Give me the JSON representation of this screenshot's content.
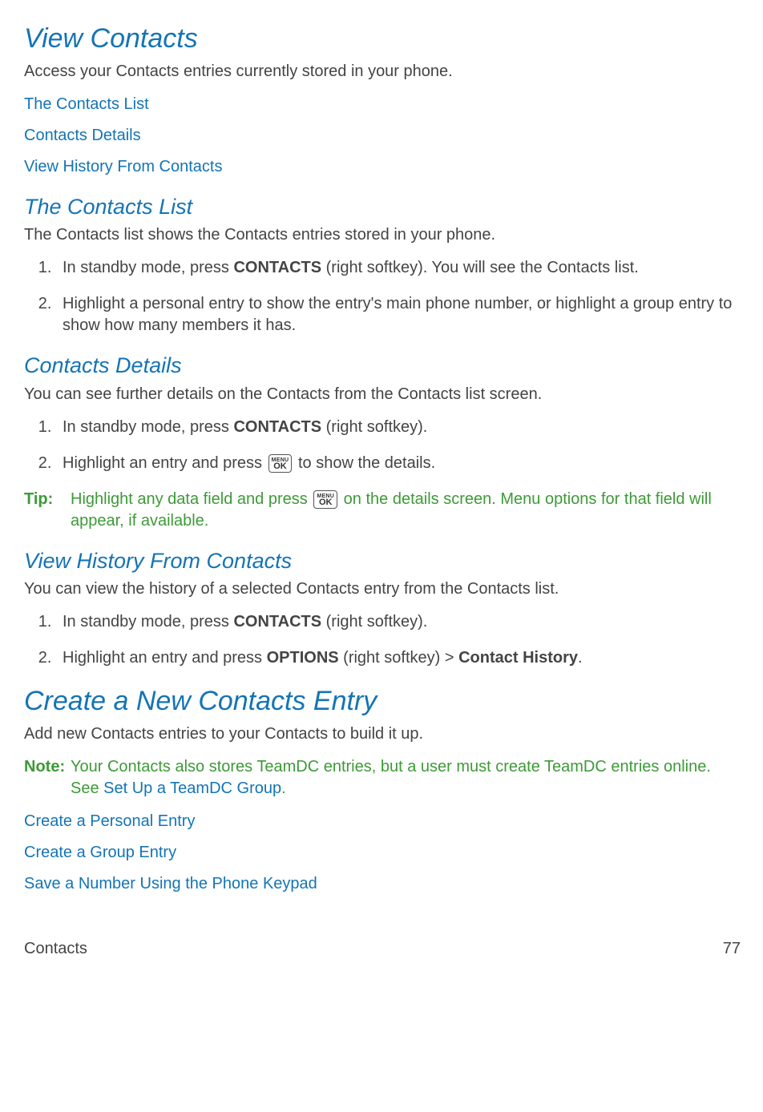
{
  "section1": {
    "title": "View Contacts",
    "desc": "Access your Contacts entries currently stored in your phone.",
    "links": [
      "The Contacts List",
      "Contacts Details",
      "View History From Contacts"
    ]
  },
  "section2": {
    "title": "The Contacts List",
    "desc": "The Contacts list shows the Contacts entries stored in your phone.",
    "step1_a": "In standby mode, press ",
    "step1_b": "CONTACTS",
    "step1_c": " (right softkey). You will see the Contacts list.",
    "step2": "Highlight a personal entry to show the entry's main phone number, or highlight a group entry to show how many members it has."
  },
  "section3": {
    "title": "Contacts Details",
    "desc": "You can see further details on the Contacts from the Contacts list screen.",
    "step1_a": "In standby mode, press ",
    "step1_b": "CONTACTS",
    "step1_c": " (right softkey).",
    "step2_a": "Highlight an entry and press ",
    "step2_b": " to show the details.",
    "tip_label": "Tip:",
    "tip_a": "Highlight any data field and press ",
    "tip_b": " on the details screen. Menu options for that field will appear, if available."
  },
  "section4": {
    "title": "View History From Contacts",
    "desc": "You can view the history of a selected Contacts entry from the Contacts list.",
    "step1_a": "In standby mode, press ",
    "step1_b": "CONTACTS",
    "step1_c": " (right softkey).",
    "step2_a": "Highlight an entry and press ",
    "step2_b": "OPTIONS",
    "step2_c": " (right softkey) > ",
    "step2_d": "Contact History",
    "step2_e": "."
  },
  "section5": {
    "title": "Create a New Contacts Entry",
    "desc": "Add new Contacts entries to your Contacts to build it up.",
    "note_label": "Note:",
    "note_a": "Your Contacts also stores TeamDC entries, but a user must create TeamDC entries online. See ",
    "note_link": "Set Up a TeamDC Group",
    "note_b": ".",
    "links": [
      "Create a Personal Entry",
      "Create a Group Entry",
      "Save a Number Using the Phone Keypad"
    ]
  },
  "footer": {
    "section": "Contacts",
    "page": "77"
  },
  "menu_ok": {
    "top": "MENU",
    "bottom": "OK"
  }
}
